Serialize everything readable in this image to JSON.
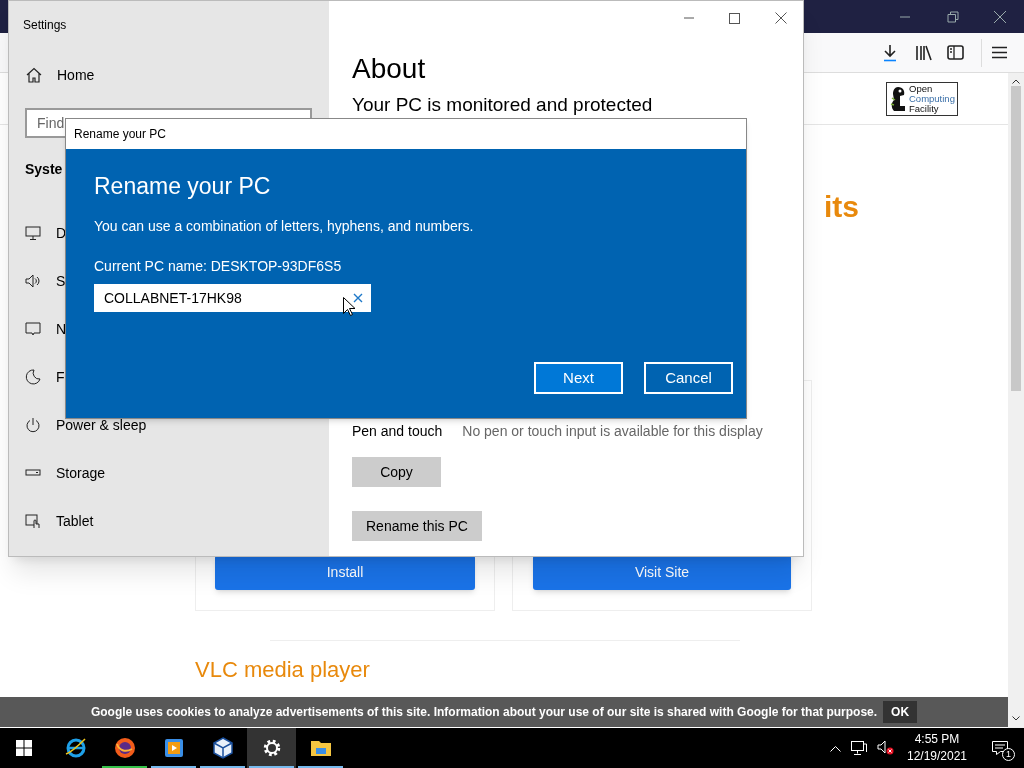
{
  "browser": {
    "logo": {
      "lines": [
        "Open",
        "Computing",
        "Facility"
      ]
    },
    "page": {
      "heading_fragment": "its",
      "card_buttons": [
        "Install",
        "Visit Site"
      ],
      "section_title": "VLC media player"
    },
    "cookie_bar": {
      "text": "Google uses cookies to analyze advertisements of this site. Information about your use of our site is shared with Google for that purpose.",
      "button": "OK"
    }
  },
  "settings": {
    "title": "Settings",
    "home": "Home",
    "search": {
      "placeholder": "Find"
    },
    "section": "Syste",
    "nav": [
      {
        "kind": "display",
        "label": "D"
      },
      {
        "kind": "sound",
        "label": "S"
      },
      {
        "kind": "notifications",
        "label": "N"
      },
      {
        "kind": "focus",
        "label": "F"
      },
      {
        "kind": "power",
        "label": "Power & sleep"
      },
      {
        "kind": "storage",
        "label": "Storage"
      },
      {
        "kind": "tablet",
        "label": "Tablet"
      }
    ],
    "page_title": "About",
    "status_text": "Your PC is monitored and protected",
    "pen_label": "Pen and touch",
    "pen_value": "No pen or touch input is available for this display",
    "buttons": [
      "Copy",
      "Rename this PC"
    ]
  },
  "dialog": {
    "title": "Rename your PC",
    "heading": "Rename your PC",
    "description": "You can use a combination of letters, hyphens, and numbers.",
    "current_name": "Current PC name: DESKTOP-93DF6S5",
    "new_name": {
      "value": "COLLABNET-17HK98"
    },
    "buttons": [
      {
        "label": "Next",
        "primary": true
      },
      {
        "label": "Cancel",
        "primary": false
      }
    ]
  },
  "taskbar": {
    "apps": [
      {
        "kind": "ie",
        "selected": false
      },
      {
        "kind": "firefox",
        "selected": false,
        "color": "#36c24a"
      },
      {
        "kind": "media",
        "selected": false,
        "color": "#76b9ed"
      },
      {
        "kind": "box",
        "selected": false,
        "color": "#76b9ed"
      },
      {
        "kind": "settings",
        "selected": true,
        "color": "#76b9ed"
      },
      {
        "kind": "folder",
        "selected": false,
        "color": "#76b9ed"
      }
    ],
    "time": "4:55 PM",
    "date": "12/19/2021",
    "notification_count": "1"
  }
}
